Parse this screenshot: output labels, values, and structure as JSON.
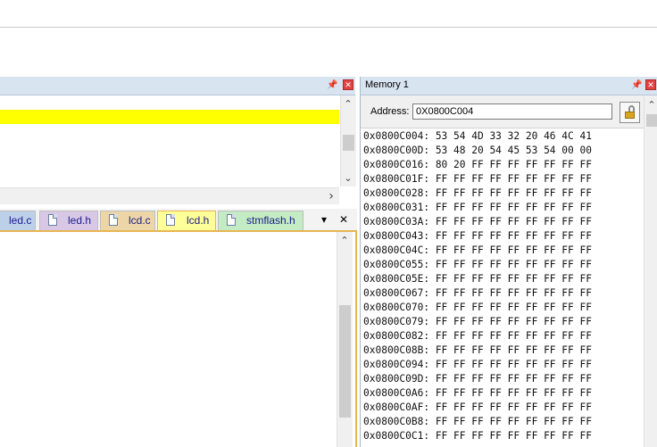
{
  "left_pane": {
    "scroll_right": "›"
  },
  "tabs": [
    {
      "label": "led.c",
      "bg": "#bcd0ea",
      "icon": false
    },
    {
      "label": "led.h",
      "bg": "#d8c8e6",
      "icon": true
    },
    {
      "label": "lcd.c",
      "bg": "#ecd6a8",
      "icon": true
    },
    {
      "label": "lcd.h",
      "bg": "#ffff99",
      "icon": true
    },
    {
      "label": "stmflash.h",
      "bg": "#c4ecc4",
      "icon": true
    }
  ],
  "tab_controls": {
    "menu": "▾",
    "close": "✕"
  },
  "memory": {
    "title": "Memory 1",
    "address_label": "Address:",
    "address_value": "0X0800C004",
    "lines": [
      "0x0800C004: 53 54 4D 33 32 20 46 4C 41",
      "0x0800C00D: 53 48 20 54 45 53 54 00 00",
      "0x0800C016: 80 20 FF FF FF FF FF FF FF",
      "0x0800C01F: FF FF FF FF FF FF FF FF FF",
      "0x0800C028: FF FF FF FF FF FF FF FF FF",
      "0x0800C031: FF FF FF FF FF FF FF FF FF",
      "0x0800C03A: FF FF FF FF FF FF FF FF FF",
      "0x0800C043: FF FF FF FF FF FF FF FF FF",
      "0x0800C04C: FF FF FF FF FF FF FF FF FF",
      "0x0800C055: FF FF FF FF FF FF FF FF FF",
      "0x0800C05E: FF FF FF FF FF FF FF FF FF",
      "0x0800C067: FF FF FF FF FF FF FF FF FF",
      "0x0800C070: FF FF FF FF FF FF FF FF FF",
      "0x0800C079: FF FF FF FF FF FF FF FF FF",
      "0x0800C082: FF FF FF FF FF FF FF FF FF",
      "0x0800C08B: FF FF FF FF FF FF FF FF FF",
      "0x0800C094: FF FF FF FF FF FF FF FF FF",
      "0x0800C09D: FF FF FF FF FF FF FF FF FF",
      "0x0800C0A6: FF FF FF FF FF FF FF FF FF",
      "0x0800C0AF: FF FF FF FF FF FF FF FF FF",
      "0x0800C0B8: FF FF FF FF FF FF FF FF FF",
      "0x0800C0C1: FF FF FF FF FF FF FF FF FF"
    ]
  },
  "icons": {
    "pin": "pin-icon",
    "close": "close-icon",
    "lock": "unlocked-lock-icon",
    "file": "file-icon"
  },
  "colors": {
    "highlight": "#ffff00",
    "pane_header": "#d9e4f1",
    "active_tab_border": "#e8b553",
    "close": "#e04343"
  }
}
